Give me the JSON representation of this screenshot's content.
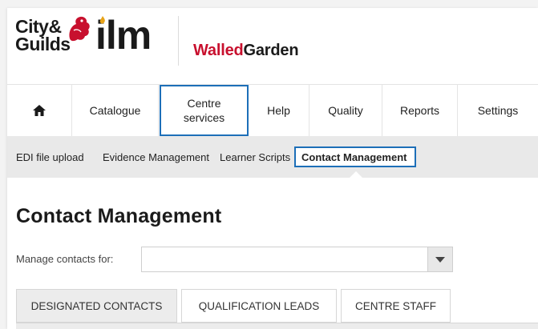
{
  "header": {
    "logo_cg_line1": "City&",
    "logo_cg_line2": "Guilds",
    "logo_ilm": "ilm",
    "brand_part1": "Walled",
    "brand_part2": "Garden",
    "colors": {
      "brand_red": "#c8102e",
      "selection_blue": "#1d6fb8"
    }
  },
  "nav": {
    "items": [
      {
        "label": "",
        "icon": "home-icon"
      },
      {
        "label": "Catalogue"
      },
      {
        "label": "Centre services",
        "selected": true
      },
      {
        "label": "Help"
      },
      {
        "label": "Quality"
      },
      {
        "label": "Reports"
      },
      {
        "label": "Settings"
      }
    ]
  },
  "subnav": {
    "items": [
      {
        "label": "EDI file upload"
      },
      {
        "label": "Evidence Management"
      },
      {
        "label": "Learner Scripts"
      },
      {
        "label": "Contact Management",
        "selected": true
      }
    ]
  },
  "main": {
    "title": "Contact Management",
    "manage_label": "Manage contacts for:",
    "manage_value": "",
    "tabs": [
      {
        "label": "DESIGNATED CONTACTS",
        "active": true
      },
      {
        "label": "QUALIFICATION LEADS"
      },
      {
        "label": "CENTRE STAFF"
      }
    ]
  }
}
